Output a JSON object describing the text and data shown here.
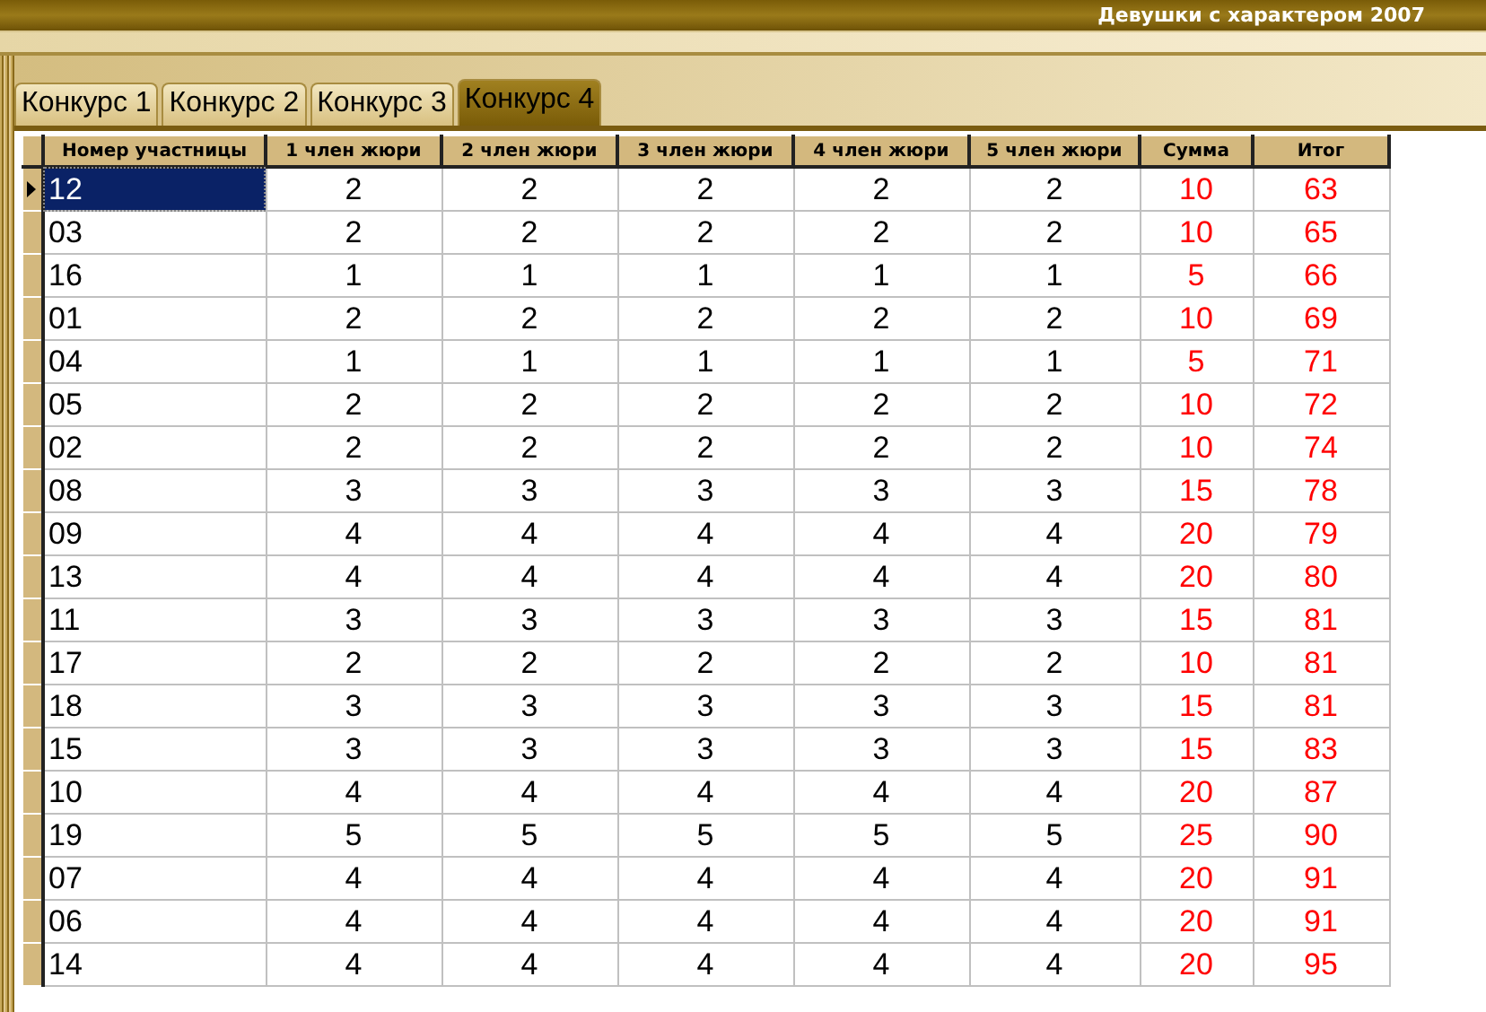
{
  "window": {
    "title": "Девушки с характером 2007"
  },
  "tabs": [
    {
      "label": "Конкурс 1",
      "selected": false
    },
    {
      "label": "Конкурс 2",
      "selected": false
    },
    {
      "label": "Конкурс 3",
      "selected": false
    },
    {
      "label": "Конкурс 4",
      "selected": true
    }
  ],
  "table": {
    "columns": [
      "Номер участницы",
      "1 член жюри",
      "2 член жюри",
      "3 член жюри",
      "4 член жюри",
      "5 член жюри",
      "Сумма",
      "Итог"
    ],
    "rows": [
      {
        "selected": true,
        "cells": [
          "12",
          "2",
          "2",
          "2",
          "2",
          "2",
          "10",
          "63"
        ]
      },
      {
        "selected": false,
        "cells": [
          "03",
          "2",
          "2",
          "2",
          "2",
          "2",
          "10",
          "65"
        ]
      },
      {
        "selected": false,
        "cells": [
          "16",
          "1",
          "1",
          "1",
          "1",
          "1",
          "5",
          "66"
        ]
      },
      {
        "selected": false,
        "cells": [
          "01",
          "2",
          "2",
          "2",
          "2",
          "2",
          "10",
          "69"
        ]
      },
      {
        "selected": false,
        "cells": [
          "04",
          "1",
          "1",
          "1",
          "1",
          "1",
          "5",
          "71"
        ]
      },
      {
        "selected": false,
        "cells": [
          "05",
          "2",
          "2",
          "2",
          "2",
          "2",
          "10",
          "72"
        ]
      },
      {
        "selected": false,
        "cells": [
          "02",
          "2",
          "2",
          "2",
          "2",
          "2",
          "10",
          "74"
        ]
      },
      {
        "selected": false,
        "cells": [
          "08",
          "3",
          "3",
          "3",
          "3",
          "3",
          "15",
          "78"
        ]
      },
      {
        "selected": false,
        "cells": [
          "09",
          "4",
          "4",
          "4",
          "4",
          "4",
          "20",
          "79"
        ]
      },
      {
        "selected": false,
        "cells": [
          "13",
          "4",
          "4",
          "4",
          "4",
          "4",
          "20",
          "80"
        ]
      },
      {
        "selected": false,
        "cells": [
          "11",
          "3",
          "3",
          "3",
          "3",
          "3",
          "15",
          "81"
        ]
      },
      {
        "selected": false,
        "cells": [
          "17",
          "2",
          "2",
          "2",
          "2",
          "2",
          "10",
          "81"
        ]
      },
      {
        "selected": false,
        "cells": [
          "18",
          "3",
          "3",
          "3",
          "3",
          "3",
          "15",
          "81"
        ]
      },
      {
        "selected": false,
        "cells": [
          "15",
          "3",
          "3",
          "3",
          "3",
          "3",
          "15",
          "83"
        ]
      },
      {
        "selected": false,
        "cells": [
          "10",
          "4",
          "4",
          "4",
          "4",
          "4",
          "20",
          "87"
        ]
      },
      {
        "selected": false,
        "cells": [
          "19",
          "5",
          "5",
          "5",
          "5",
          "5",
          "25",
          "90"
        ]
      },
      {
        "selected": false,
        "cells": [
          "07",
          "4",
          "4",
          "4",
          "4",
          "4",
          "20",
          "91"
        ]
      },
      {
        "selected": false,
        "cells": [
          "06",
          "4",
          "4",
          "4",
          "4",
          "4",
          "20",
          "91"
        ]
      },
      {
        "selected": false,
        "cells": [
          "14",
          "4",
          "4",
          "4",
          "4",
          "4",
          "20",
          "95"
        ]
      }
    ]
  }
}
